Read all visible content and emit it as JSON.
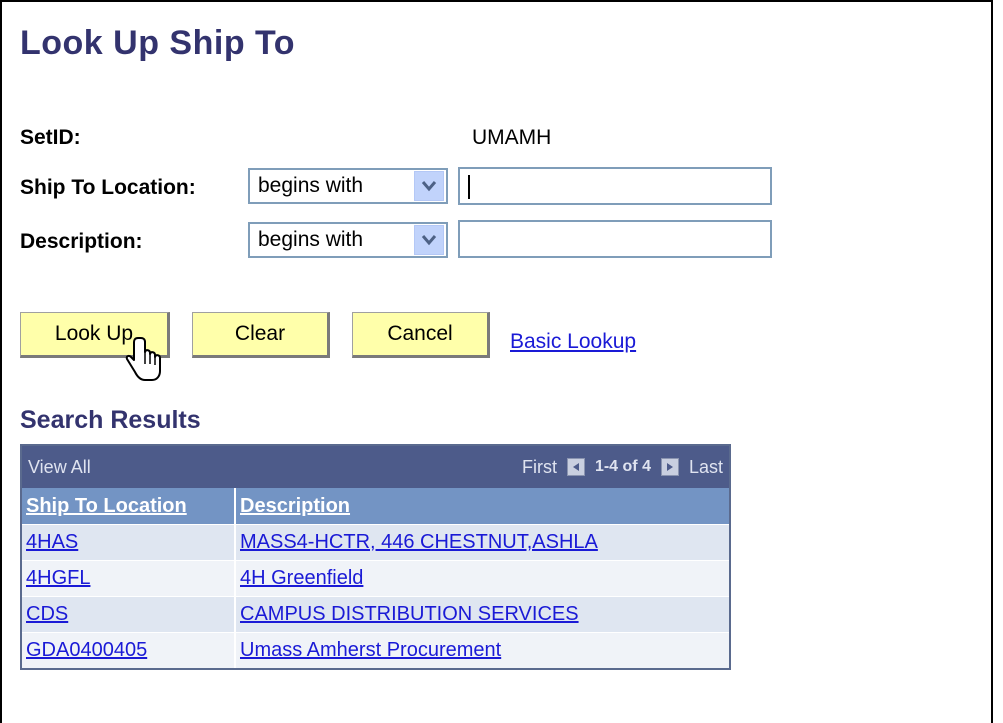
{
  "page": {
    "title": "Look Up Ship To"
  },
  "form": {
    "setid_label": "SetID:",
    "setid_value": "UMAMH",
    "ship_to_label": "Ship To Location:",
    "ship_to_operator": "begins with",
    "ship_to_value": "",
    "description_label": "Description:",
    "description_operator": "begins with",
    "description_value": ""
  },
  "buttons": {
    "lookup": "Look Up",
    "clear": "Clear",
    "cancel": "Cancel",
    "basic_lookup": "Basic Lookup"
  },
  "results": {
    "title": "Search Results",
    "view_all": "View All",
    "first": "First",
    "range": "1-4 of 4",
    "last": "Last",
    "columns": [
      "Ship To Location",
      "Description"
    ],
    "rows": [
      {
        "location": "4HAS",
        "description": "MASS4-HCTR, 446 CHESTNUT,ASHLA"
      },
      {
        "location": "4HGFL",
        "description": "4H Greenfield"
      },
      {
        "location": "CDS",
        "description": "CAMPUS DISTRIBUTION SERVICES"
      },
      {
        "location": "GDA0400405",
        "description": "Umass Amherst Procurement"
      }
    ]
  },
  "icons": {
    "dropdown": "chevron-down-icon",
    "prev": "prev-page-icon",
    "next": "next-page-icon",
    "cursor": "hand-cursor-icon"
  },
  "colors": {
    "title": "#33336e",
    "button_bg": "#ffffaa",
    "link": "#1a1ad6",
    "grid_nav": "#4d5b8a",
    "grid_header": "#7394c4",
    "row_alt": "#dfe6f1"
  }
}
